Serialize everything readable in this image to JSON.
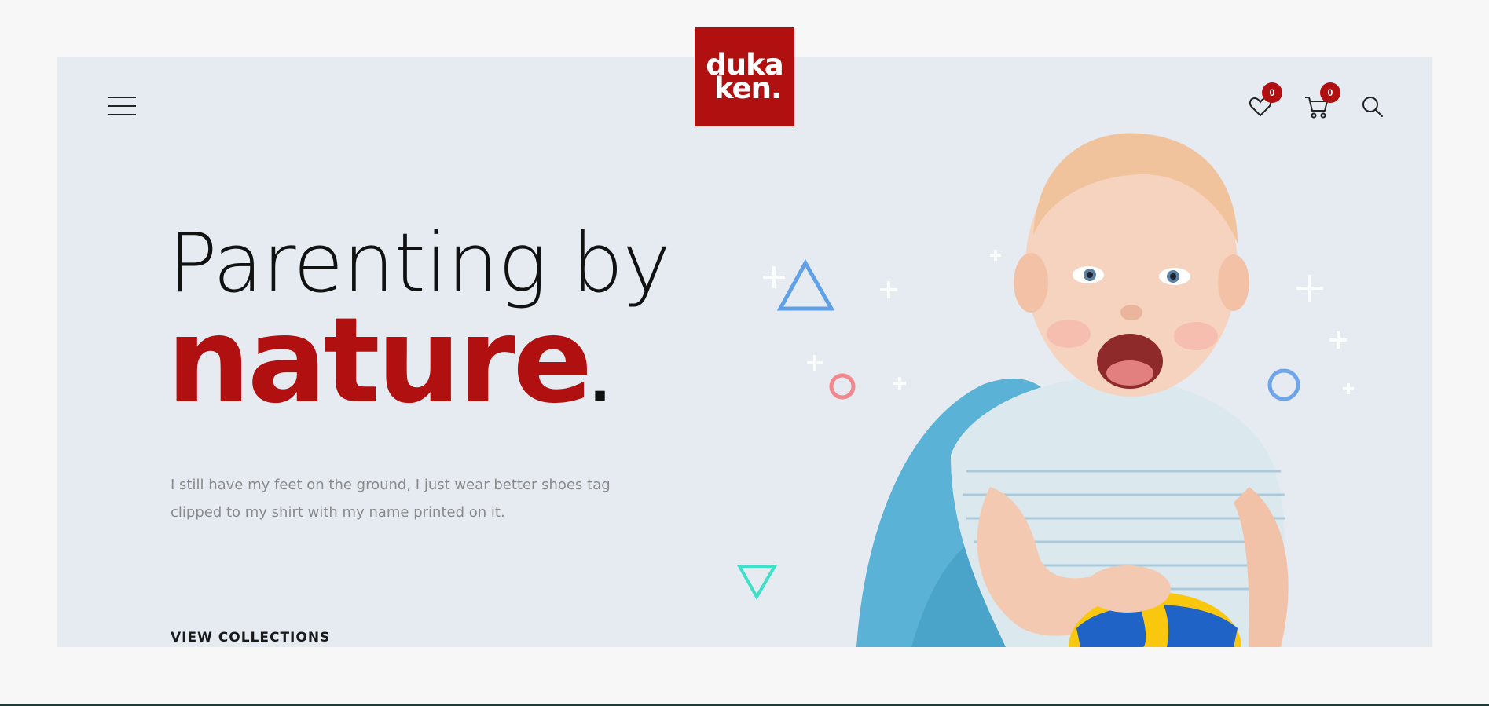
{
  "brand": {
    "logo_line1": "duka",
    "logo_line2": "ken.",
    "color": "#b11010"
  },
  "header": {
    "menu_icon": "hamburger-menu-icon",
    "wishlist": {
      "icon": "heart-icon",
      "count": "0"
    },
    "cart": {
      "icon": "cart-icon",
      "count": "0"
    },
    "search": {
      "icon": "search-icon"
    }
  },
  "hero": {
    "headline_line1": "Parenting by",
    "headline_line2": "nature",
    "headline_dot": ".",
    "description": "I still have my feet on the ground, I just wear better shoes tag clipped to my shirt with my name printed on it.",
    "cta": "VIEW COLLECTIONS",
    "background": "#e5ebf1",
    "image": "baby-with-ball-image"
  }
}
